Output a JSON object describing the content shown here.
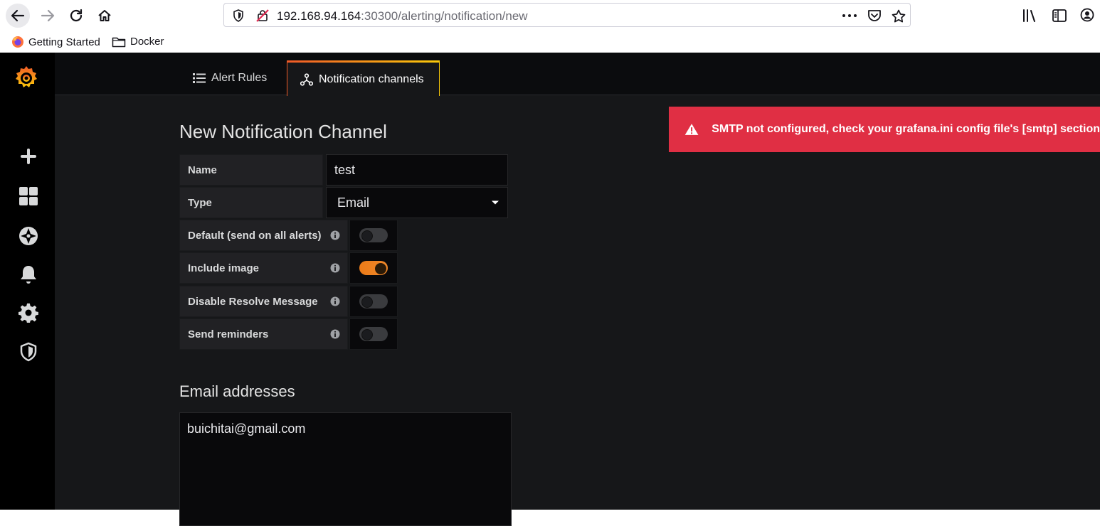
{
  "browser": {
    "url_host": "192.168.94.164",
    "url_path": ":30300/alerting/notification/new",
    "bookmarks": [
      {
        "label": "Getting Started",
        "icon": "firefox-icon"
      },
      {
        "label": "Docker",
        "icon": "folder-icon"
      }
    ]
  },
  "tabs": {
    "alert_rules": "Alert Rules",
    "notification_channels": "Notification channels"
  },
  "page": {
    "title": "New Notification Channel"
  },
  "form": {
    "name_label": "Name",
    "name_value": "test",
    "type_label": "Type",
    "type_value": "Email",
    "toggles": [
      {
        "label": "Default (send on all alerts)",
        "on": false
      },
      {
        "label": "Include image",
        "on": true
      },
      {
        "label": "Disable Resolve Message",
        "on": false
      },
      {
        "label": "Send reminders",
        "on": false
      }
    ]
  },
  "email": {
    "section_title": "Email addresses",
    "addresses": "buichitai@gmail.com"
  },
  "alert": {
    "message": "SMTP not configured, check your grafana.ini config file's [smtp] section"
  },
  "colors": {
    "accent": "#eb7b18",
    "error": "#e02f44",
    "background": "#161719"
  }
}
